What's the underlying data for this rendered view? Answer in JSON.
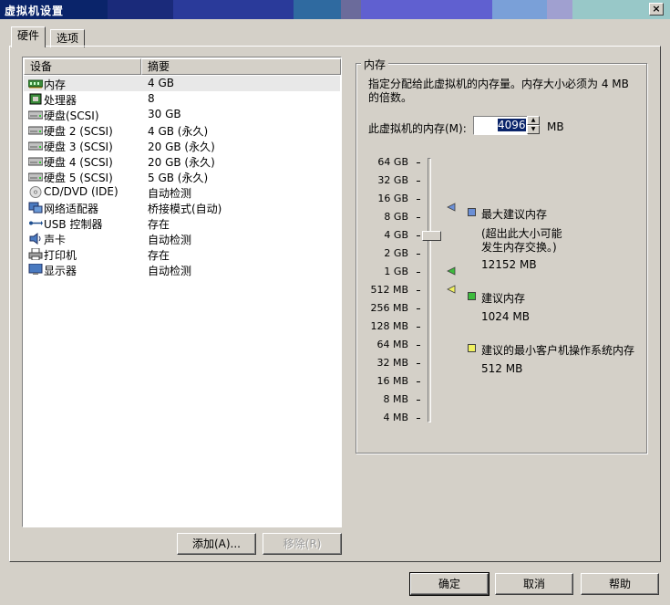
{
  "window": {
    "title": "虚拟机设置",
    "close_label": "×",
    "titlebar_colors": [
      "#0a246a",
      "#1a2a7a",
      "#2a3a9a",
      "#2f6aa0",
      "#6b6b9b",
      "#6060d0",
      "#7aa0d8",
      "#a0a0d0",
      "#98c8c8",
      "#a6caf0"
    ]
  },
  "tabs": [
    {
      "label": "硬件",
      "active": true
    },
    {
      "label": "选项",
      "active": false
    }
  ],
  "device_list": {
    "columns": [
      "设备",
      "摘要"
    ],
    "rows": [
      {
        "icon": "memory-icon",
        "name": "内存",
        "summary": "4 GB",
        "selected": true
      },
      {
        "icon": "processor-icon",
        "name": "处理器",
        "summary": "8"
      },
      {
        "icon": "hard-disk-icon",
        "name": "硬盘(SCSI)",
        "summary": "30 GB"
      },
      {
        "icon": "hard-disk-icon",
        "name": "硬盘 2 (SCSI)",
        "summary": "4 GB (永久)"
      },
      {
        "icon": "hard-disk-icon",
        "name": "硬盘 3 (SCSI)",
        "summary": "20 GB (永久)"
      },
      {
        "icon": "hard-disk-icon",
        "name": "硬盘 4 (SCSI)",
        "summary": "20 GB (永久)"
      },
      {
        "icon": "hard-disk-icon",
        "name": "硬盘 5 (SCSI)",
        "summary": "5 GB (永久)"
      },
      {
        "icon": "cd-dvd-icon",
        "name": "CD/DVD (IDE)",
        "summary": "自动检测"
      },
      {
        "icon": "network-adapter-icon",
        "name": "网络适配器",
        "summary": "桥接模式(自动)"
      },
      {
        "icon": "usb-icon",
        "name": "USB 控制器",
        "summary": "存在"
      },
      {
        "icon": "sound-card-icon",
        "name": "声卡",
        "summary": "自动检测"
      },
      {
        "icon": "printer-icon",
        "name": "打印机",
        "summary": "存在"
      },
      {
        "icon": "display-icon",
        "name": "显示器",
        "summary": "自动检测"
      }
    ]
  },
  "list_buttons": {
    "add": "添加(A)...",
    "remove": "移除(R)"
  },
  "memory": {
    "group_title": "内存",
    "description_line1": "指定分配给此虚拟机的内存量。内存大小必须为 4 MB",
    "description_line2": "的倍数。",
    "field_label": "此虚拟机的内存(M):",
    "field_value": "4096",
    "unit": "MB",
    "slider_ticks": [
      "64 GB",
      "32 GB",
      "16 GB",
      "8 GB",
      "4 GB",
      "2 GB",
      "1 GB",
      "512 MB",
      "256 MB",
      "128 MB",
      "64 MB",
      "32 MB",
      "16 MB",
      "8 MB",
      "4 MB"
    ],
    "slider_value": "4 GB",
    "legend": [
      {
        "color": "#6b8fd6",
        "title": "最大建议内存",
        "note_line1": "(超出此大小可能",
        "note_line2": "发生内存交换。)",
        "value": "12152 MB"
      },
      {
        "color": "#3dbb3d",
        "title": "建议内存",
        "value": "1024 MB"
      },
      {
        "color": "#f0f060",
        "title": "建议的最小客户机操作系统内存",
        "value": "512 MB"
      }
    ]
  },
  "dialog_buttons": {
    "ok": "确定",
    "cancel": "取消",
    "help": "帮助"
  }
}
